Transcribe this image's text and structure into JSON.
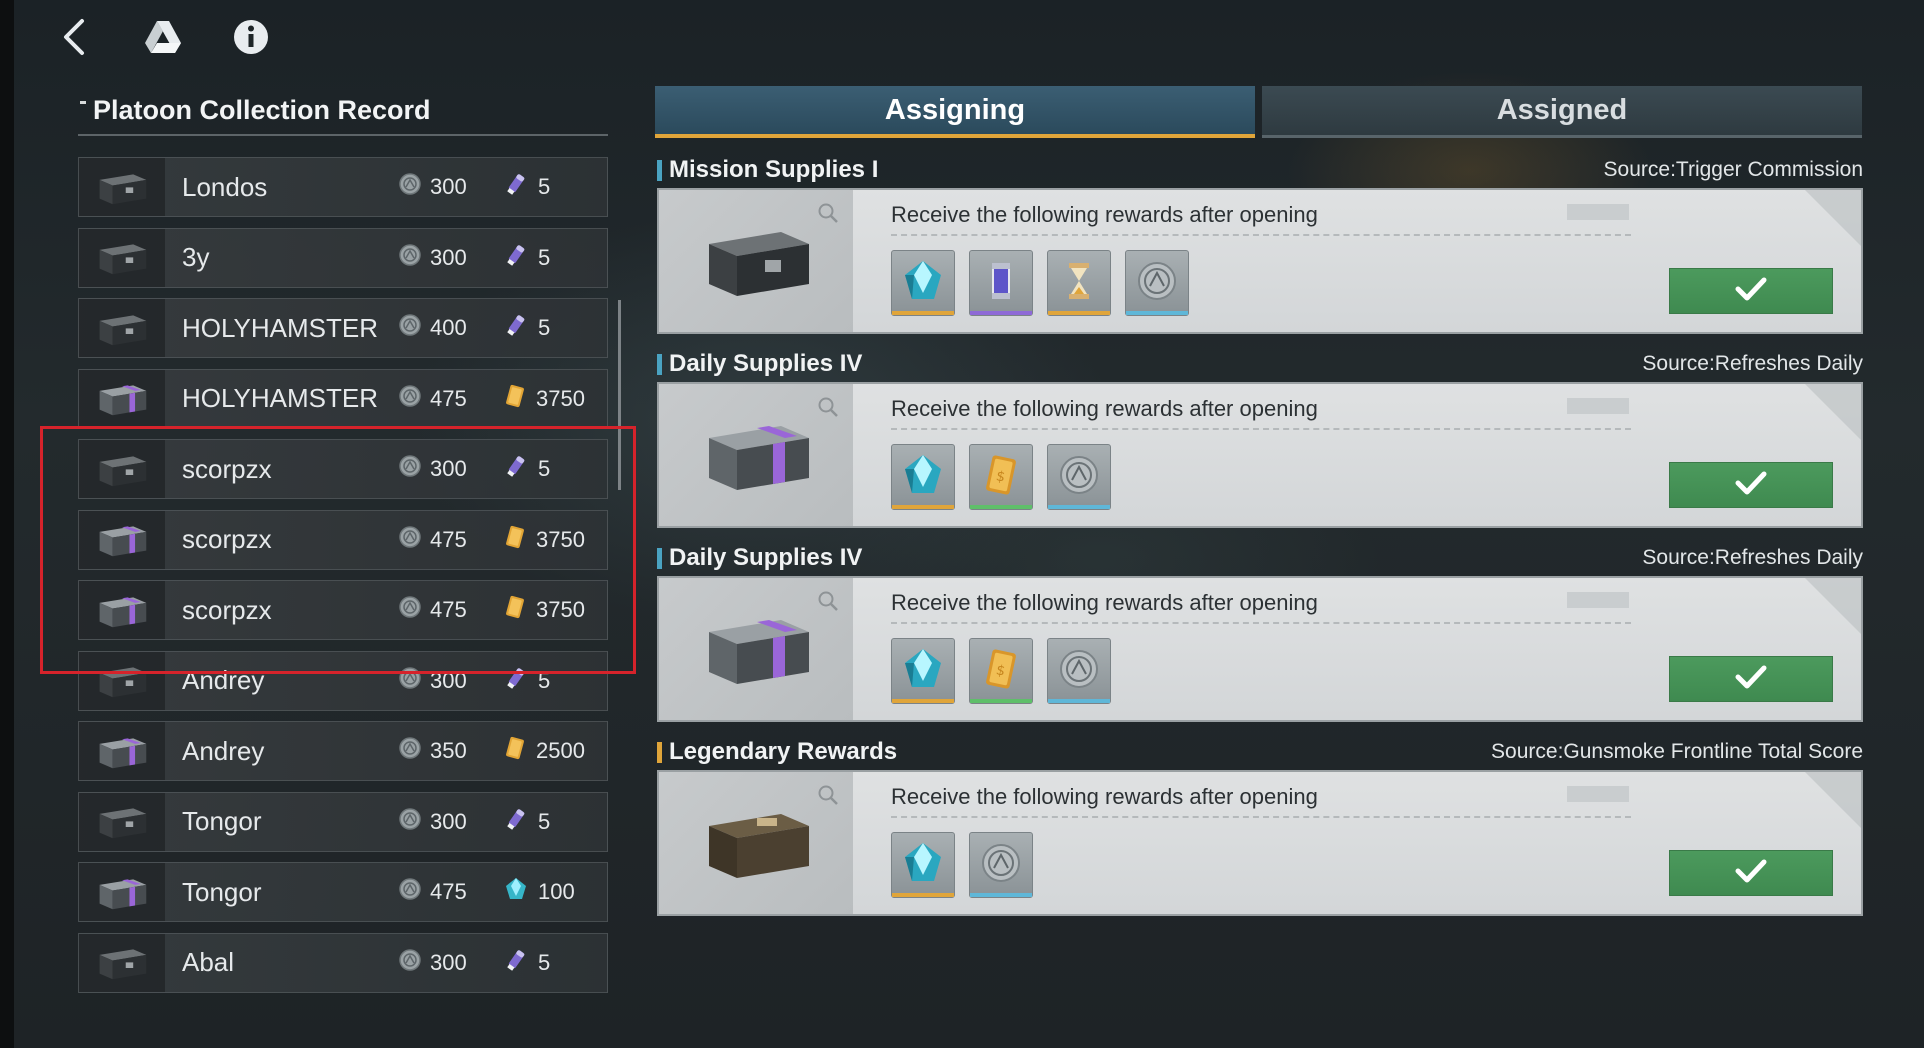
{
  "topbar": {
    "icons": [
      "back-arrow-icon",
      "drive-logo-icon",
      "info-icon"
    ]
  },
  "left_panel": {
    "title": "Platoon Collection Record",
    "records": [
      {
        "name": "Londos",
        "coin": "300",
        "reward": "5",
        "reward_icon": "ammo-icon",
        "chest": "dark-chest"
      },
      {
        "name": "3y",
        "coin": "300",
        "reward": "5",
        "reward_icon": "ammo-icon",
        "chest": "dark-chest"
      },
      {
        "name": "HOLYHAMSTER",
        "coin": "400",
        "reward": "5",
        "reward_icon": "ammo-icon",
        "chest": "dark-chest"
      },
      {
        "name": "HOLYHAMSTER",
        "coin": "475",
        "reward": "3750",
        "reward_icon": "gold-bar-icon",
        "chest": "purple-chest"
      },
      {
        "name": "scorpzx",
        "coin": "300",
        "reward": "5",
        "reward_icon": "ammo-icon",
        "chest": "dark-chest"
      },
      {
        "name": "scorpzx",
        "coin": "475",
        "reward": "3750",
        "reward_icon": "gold-bar-icon",
        "chest": "purple-chest"
      },
      {
        "name": "scorpzx",
        "coin": "475",
        "reward": "3750",
        "reward_icon": "gold-bar-icon",
        "chest": "purple-chest"
      },
      {
        "name": "Andrey",
        "coin": "300",
        "reward": "5",
        "reward_icon": "ammo-icon",
        "chest": "dark-chest"
      },
      {
        "name": "Andrey",
        "coin": "350",
        "reward": "2500",
        "reward_icon": "gold-bar-icon",
        "chest": "purple-chest"
      },
      {
        "name": "Tongor",
        "coin": "300",
        "reward": "5",
        "reward_icon": "ammo-icon",
        "chest": "dark-chest"
      },
      {
        "name": "Tongor",
        "coin": "475",
        "reward": "100",
        "reward_icon": "crystal-icon",
        "chest": "purple-chest"
      },
      {
        "name": "Abal",
        "coin": "300",
        "reward": "5",
        "reward_icon": "ammo-icon",
        "chest": "dark-chest"
      }
    ]
  },
  "tabs": {
    "assigning": "Assigning",
    "assigned": "Assigned"
  },
  "cards": [
    {
      "title": "Mission Supplies I",
      "source": "Source:Trigger Commission",
      "description": "Receive the following rewards after opening",
      "chest": "dark-chest",
      "items": [
        {
          "icon": "crystal-icon",
          "rarity": "gold"
        },
        {
          "icon": "capsule-icon",
          "rarity": "purple"
        },
        {
          "icon": "hourglass-icon",
          "rarity": "gold"
        },
        {
          "icon": "coin-icon",
          "rarity": "blue"
        }
      ]
    },
    {
      "title": "Daily Supplies IV",
      "source": "Source:Refreshes Daily",
      "description": "Receive the following rewards after opening",
      "chest": "purple-chest",
      "items": [
        {
          "icon": "crystal-icon",
          "rarity": "gold"
        },
        {
          "icon": "gold-bar-icon",
          "rarity": "green"
        },
        {
          "icon": "coin-icon",
          "rarity": "blue"
        }
      ]
    },
    {
      "title": "Daily Supplies IV",
      "source": "Source:Refreshes Daily",
      "description": "Receive the following rewards after opening",
      "chest": "purple-chest",
      "items": [
        {
          "icon": "crystal-icon",
          "rarity": "gold"
        },
        {
          "icon": "gold-bar-icon",
          "rarity": "green"
        },
        {
          "icon": "coin-icon",
          "rarity": "blue"
        }
      ]
    },
    {
      "title": "Legendary Rewards",
      "source": "Source:Gunsmoke Frontline Total Score",
      "description": "Receive the following rewards after opening",
      "chest": "brown-chest",
      "items": [
        {
          "icon": "crystal-icon",
          "rarity": "gold"
        },
        {
          "icon": "coin-icon",
          "rarity": "blue"
        }
      ]
    }
  ],
  "colors": {
    "accent_gold": "#e0a53a",
    "tab_active": "#3b5e73",
    "confirm_green": "#4c9a5d",
    "highlight_red": "#d6232b"
  }
}
